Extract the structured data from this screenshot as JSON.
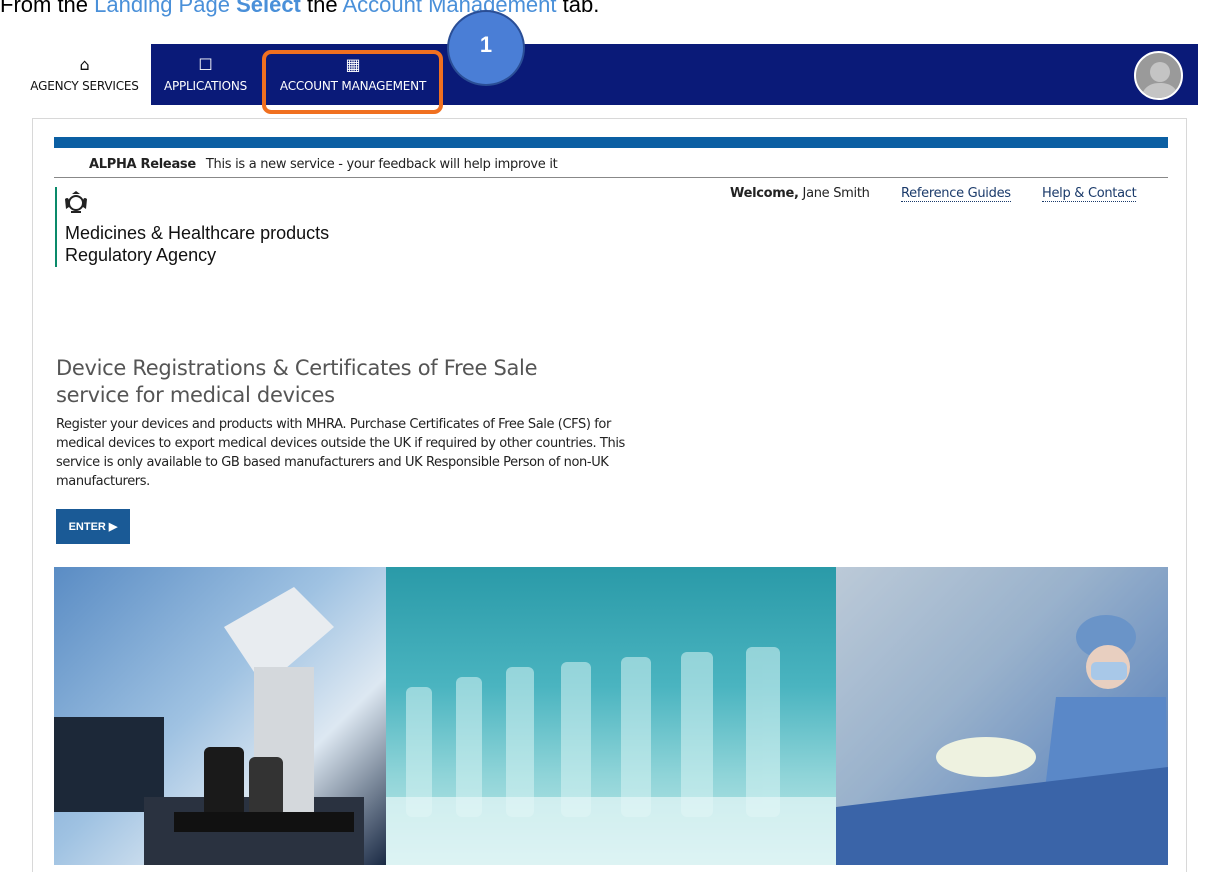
{
  "instruction": {
    "prefix": "From the ",
    "landing_link": "Landing Page",
    "space": " ",
    "select": "Select",
    "the": " the ",
    "account_link": "Account Management",
    "suffix": " tab."
  },
  "nav": {
    "tabs": [
      {
        "label": "AGENCY SERVICES",
        "icon": "home-icon",
        "glyph": "⌂"
      },
      {
        "label": "APPLICATIONS",
        "icon": "document-icon",
        "glyph": "☐"
      },
      {
        "label": "ACCOUNT MANAGEMENT",
        "icon": "building-icon",
        "glyph": "▦"
      }
    ],
    "active_tab": "AGENCY SERVICES"
  },
  "annotation": {
    "step_number": "1",
    "highlight_color": "#f07020"
  },
  "banner": {
    "phase": "ALPHA Release",
    "message": "This is a new service - your feedback will help improve it"
  },
  "header": {
    "org_line1": "Medicines & Healthcare products",
    "org_line2": "Regulatory Agency",
    "welcome_label": "Welcome,",
    "user_name": "Jane Smith",
    "links": [
      "Reference Guides",
      "Help & Contact"
    ]
  },
  "hero": {
    "title": "Device Registrations & Certificates of Free Sale service for medical devices",
    "description": "Register your devices and products with MHRA. Purchase Certificates of Free Sale (CFS) for medical devices to export medical devices outside the UK if required by other countries. This service is only available to GB based manufacturers and UK Responsible Person of non-UK manufacturers.",
    "enter_label": "ENTER ▶"
  },
  "colors": {
    "nav_background": "#0a1a78",
    "accent_bar": "#0b5fa3",
    "link": "#4a90d9",
    "button": "#1a5a96"
  }
}
